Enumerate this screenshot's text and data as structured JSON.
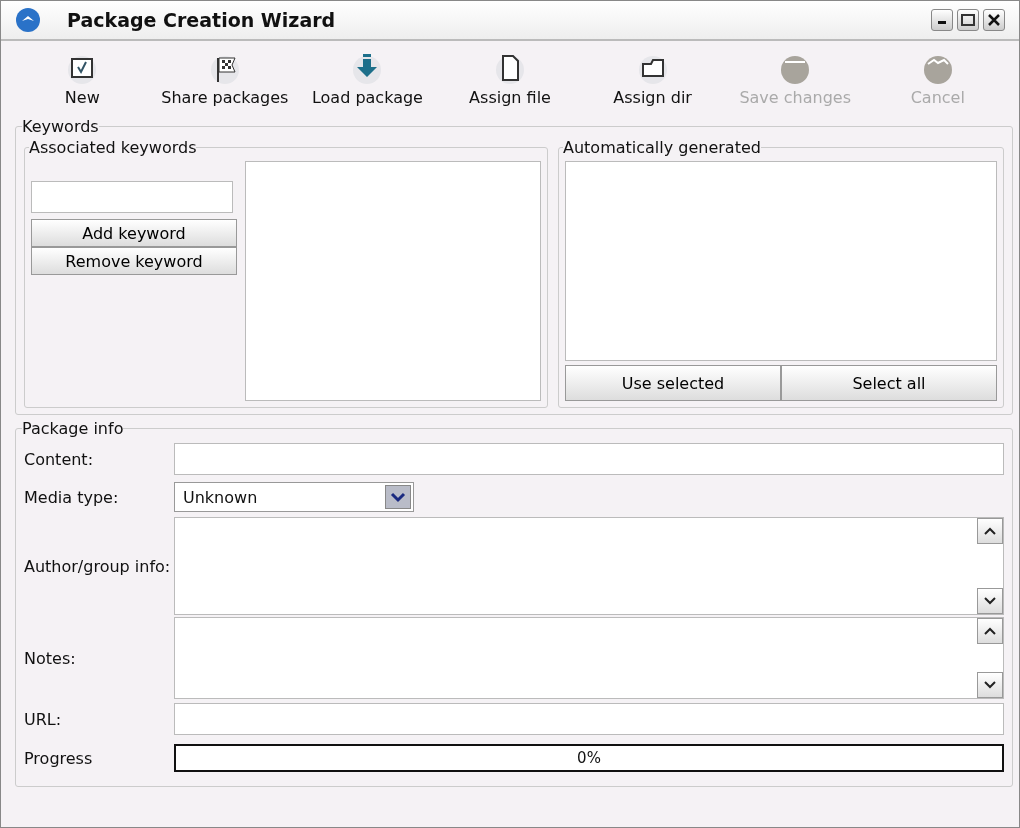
{
  "window": {
    "title": "Package Creation Wizard"
  },
  "toolbar": [
    {
      "label": "New",
      "disabled": false
    },
    {
      "label": "Share packages",
      "disabled": false
    },
    {
      "label": "Load package",
      "disabled": false
    },
    {
      "label": "Assign file",
      "disabled": false
    },
    {
      "label": "Assign dir",
      "disabled": false
    },
    {
      "label": "Save changes",
      "disabled": true
    },
    {
      "label": "Cancel",
      "disabled": true
    }
  ],
  "keywords": {
    "title": "Keywords",
    "associated": {
      "title": "Associated keywords",
      "add_button": "Add keyword",
      "remove_button": "Remove keyword"
    },
    "generated": {
      "title": "Automatically generated",
      "buttons": [
        "Use selected",
        "Select all"
      ]
    }
  },
  "package_info": {
    "title": "Package info",
    "fields": [
      {
        "label": "Content:",
        "kind": "text"
      },
      {
        "label": "Media type:",
        "kind": "select",
        "value": "Unknown"
      },
      {
        "label": "Author/group info:",
        "kind": "memo"
      },
      {
        "label": "Notes:",
        "kind": "memo"
      },
      {
        "label": "URL:",
        "kind": "text"
      }
    ],
    "progress": {
      "label": "Progress",
      "level": 0,
      "reading": "0%"
    }
  }
}
